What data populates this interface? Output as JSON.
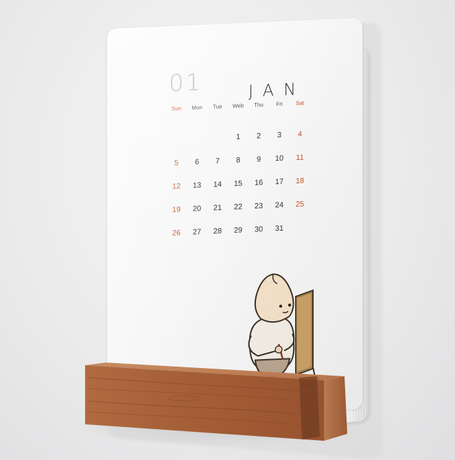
{
  "calendar": {
    "month_number": "01",
    "month_name": "JAN",
    "weekdays": [
      {
        "label": "Sun",
        "red": true
      },
      {
        "label": "Mon",
        "red": false
      },
      {
        "label": "Tue",
        "red": false
      },
      {
        "label": "Web",
        "red": false
      },
      {
        "label": "Thu",
        "red": false
      },
      {
        "label": "Fri",
        "red": false
      },
      {
        "label": "Sat",
        "red": true
      }
    ],
    "weeks": [
      [
        "",
        "",
        "",
        "1",
        "2",
        "3",
        "4"
      ],
      [
        "5",
        "6",
        "7",
        "8",
        "9",
        "10",
        "11"
      ],
      [
        "12",
        "13",
        "14",
        "15",
        "16",
        "17",
        "18"
      ],
      [
        "19",
        "20",
        "21",
        "22",
        "23",
        "24",
        "25"
      ],
      [
        "26",
        "27",
        "28",
        "29",
        "30",
        "31",
        ""
      ]
    ]
  },
  "colors": {
    "weekend": "#c9502a",
    "wood": "#a6613a",
    "board": "#c9a165"
  },
  "illustration": {
    "character": "mochi-character-icon",
    "easel": "easel-board-icon"
  }
}
